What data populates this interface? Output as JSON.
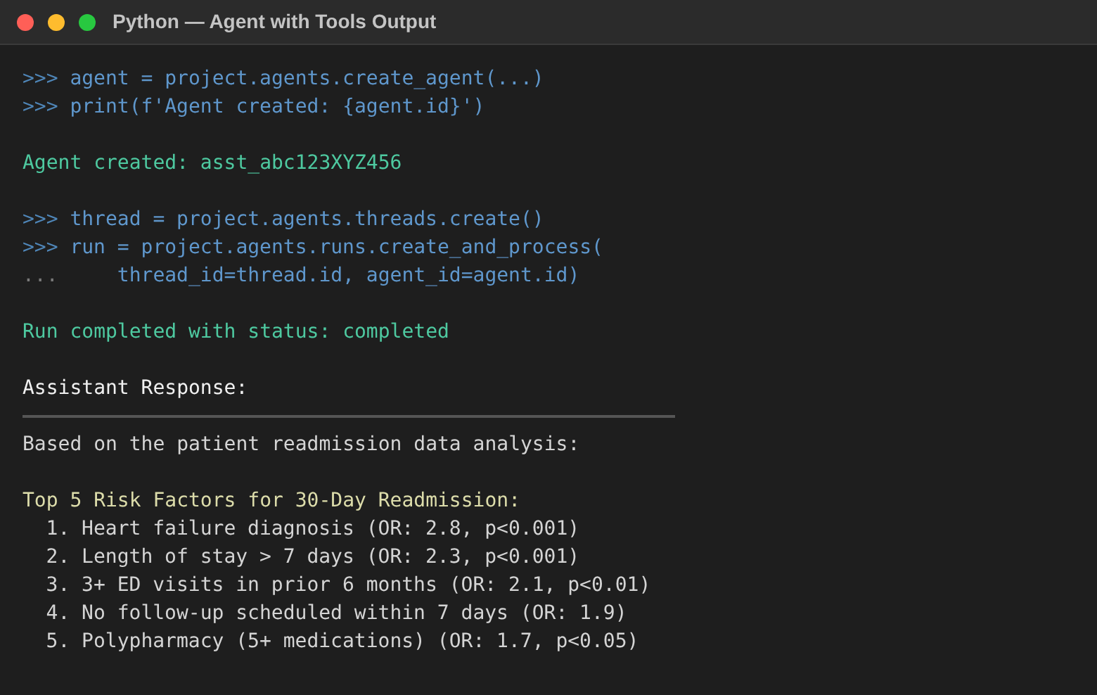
{
  "window": {
    "title": "Python — Agent with Tools Output"
  },
  "lines": [
    {
      "kind": "prompt",
      "prompt": ">>>",
      "code": "agent = project.agents.create_agent(...)"
    },
    {
      "kind": "prompt",
      "prompt": ">>>",
      "code": "print(f'Agent created: {agent.id}')"
    },
    {
      "kind": "blank"
    },
    {
      "kind": "output",
      "text": "Agent created: asst_abc123XYZ456"
    },
    {
      "kind": "blank"
    },
    {
      "kind": "prompt",
      "prompt": ">>>",
      "code": "thread = project.agents.threads.create()"
    },
    {
      "kind": "prompt",
      "prompt": ">>>",
      "code": "run = project.agents.runs.create_and_process("
    },
    {
      "kind": "continuation",
      "prompt": "...",
      "code": "    thread_id=thread.id, agent_id=agent.id)"
    },
    {
      "kind": "blank"
    },
    {
      "kind": "output",
      "text": "Run completed with status: completed"
    },
    {
      "kind": "blank"
    },
    {
      "kind": "heading",
      "text": "Assistant Response:"
    },
    {
      "kind": "rule"
    },
    {
      "kind": "text",
      "text": "Based on the patient readmission data analysis:"
    },
    {
      "kind": "blank"
    },
    {
      "kind": "section",
      "text": "Top 5 Risk Factors for 30-Day Readmission:"
    },
    {
      "kind": "item",
      "number": "1.",
      "text": "Heart failure diagnosis (OR: 2.8, p<0.001)"
    },
    {
      "kind": "item",
      "number": "2.",
      "text": "Length of stay > 7 days (OR: 2.3, p<0.001)"
    },
    {
      "kind": "item",
      "number": "3.",
      "text": "3+ ED visits in prior 6 months (OR: 2.1, p<0.01)"
    },
    {
      "kind": "item",
      "number": "4.",
      "text": "No follow-up scheduled within 7 days (OR: 1.9)"
    },
    {
      "kind": "item",
      "number": "5.",
      "text": "Polypharmacy (5+ medications) (OR: 1.7, p<0.05)"
    }
  ]
}
